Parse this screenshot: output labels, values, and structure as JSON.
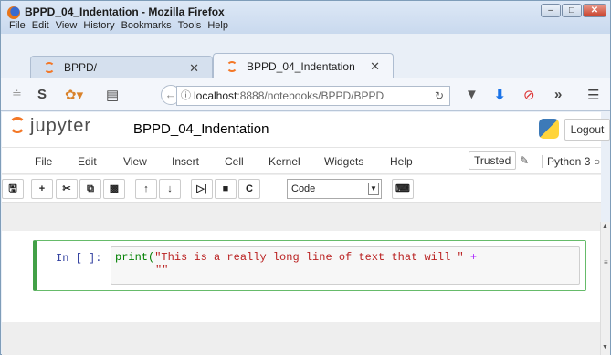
{
  "window": {
    "title": "BPPD_04_Indentation - Mozilla Firefox",
    "menu": [
      "File",
      "Edit",
      "View",
      "History",
      "Bookmarks",
      "Tools",
      "Help"
    ]
  },
  "tabs": [
    {
      "label": "BPPD/",
      "active": false
    },
    {
      "label": "BPPD_04_Indentation",
      "active": true
    }
  ],
  "url": {
    "host": "localhost",
    "path": ":8888/notebooks/BPPD/BPPD"
  },
  "jupyter": {
    "brand": "jupyter",
    "notebook_title": "BPPD_04_Indentation",
    "logout": "Logout",
    "menu": [
      "File",
      "Edit",
      "View",
      "Insert",
      "Cell",
      "Kernel",
      "Widgets",
      "Help"
    ],
    "trusted": "Trusted",
    "kernel": "Python 3",
    "cell_type": "Code"
  },
  "cell": {
    "prompt": "In [ ]:",
    "code_fn": "print(",
    "code_str1": "\"This is a really long line of text that will \"",
    "code_op": " +",
    "code_str2": "\"\""
  }
}
